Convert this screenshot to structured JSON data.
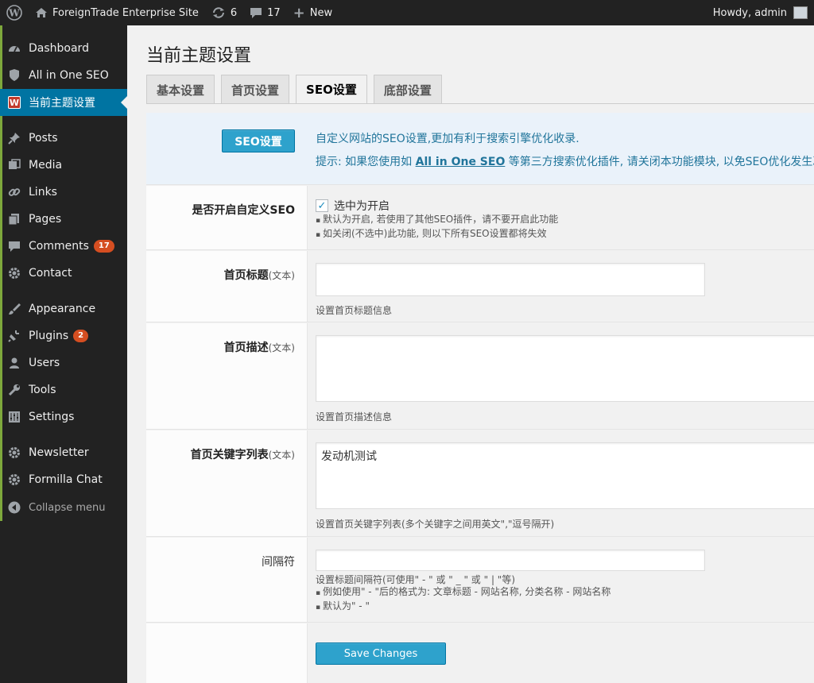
{
  "adminbar": {
    "site_name": "ForeignTrade Enterprise Site",
    "updates_count": "6",
    "comments_count": "17",
    "new_label": "New",
    "howdy": "Howdy, admin"
  },
  "sidebar": {
    "items": [
      {
        "label": "Dashboard",
        "icon": "dashboard-icon"
      },
      {
        "label": "All in One SEO",
        "icon": "shield-icon"
      },
      {
        "label": "当前主题设置",
        "icon": "theme-w-icon",
        "current": true
      },
      {
        "label": "Posts",
        "icon": "pin-icon"
      },
      {
        "label": "Media",
        "icon": "media-icon"
      },
      {
        "label": "Links",
        "icon": "link-icon"
      },
      {
        "label": "Pages",
        "icon": "pages-icon"
      },
      {
        "label": "Comments",
        "icon": "comment-icon",
        "badge": "17"
      },
      {
        "label": "Contact",
        "icon": "gear-icon"
      },
      {
        "label": "Appearance",
        "icon": "brush-icon"
      },
      {
        "label": "Plugins",
        "icon": "plugin-icon",
        "badge": "2"
      },
      {
        "label": "Users",
        "icon": "user-icon"
      },
      {
        "label": "Tools",
        "icon": "wrench-icon"
      },
      {
        "label": "Settings",
        "icon": "settings-icon"
      },
      {
        "label": "Newsletter",
        "icon": "gear-icon"
      },
      {
        "label": "Formilla Chat",
        "icon": "gear-icon"
      }
    ],
    "collapse_label": "Collapse menu"
  },
  "page": {
    "title": "当前主题设置",
    "tabs": [
      "基本设置",
      "首页设置",
      "SEO设置",
      "底部设置"
    ],
    "active_tab": "SEO设置"
  },
  "seo": {
    "section_button": "SEO设置",
    "intro": "自定义网站的SEO设置,更加有利于搜索引擎优化收录.",
    "hint_prefix": "提示: 如果您使用如 ",
    "hint_link": "All in One SEO",
    "hint_suffix": " 等第三方搜索优化插件, 请关闭本功能模块, 以免SEO优化发生冲突",
    "enable": {
      "label": "是否开启自定义SEO",
      "checkbox_label": "选中为开启",
      "checked": true,
      "note1": "默认为开启, 若使用了其他SEO插件，请不要开启此功能",
      "note2": "如关闭(不选中)此功能, 则以下所有SEO设置都将失效"
    },
    "home_title": {
      "label": "首页标题",
      "label_suffix": "(文本)",
      "value": "",
      "desc": "设置首页标题信息"
    },
    "home_desc": {
      "label": "首页描述",
      "label_suffix": "(文本)",
      "value": "",
      "desc": "设置首页描述信息"
    },
    "keywords": {
      "label": "首页关键字列表",
      "label_suffix": "(文本)",
      "value": "发动机测试",
      "desc": "设置首页关键字列表(多个关键字之间用英文\",\"逗号隔开)"
    },
    "separator": {
      "label": "间隔符",
      "value": "",
      "desc": "设置标题间隔符(可使用\" - \" 或 \" _ \" 或 \" | \"等)",
      "note1": "例如使用\" - \"后的格式为: 文章标题 - 网站名称, 分类名称 - 网站名称",
      "note2": "默认为\" - \""
    },
    "save_label": "Save Changes"
  },
  "colors": {
    "adminbar_bg": "#222222",
    "menu_current_bg": "#0074a2",
    "button_blue": "#2ea2cc",
    "badge": "#d54e21"
  }
}
